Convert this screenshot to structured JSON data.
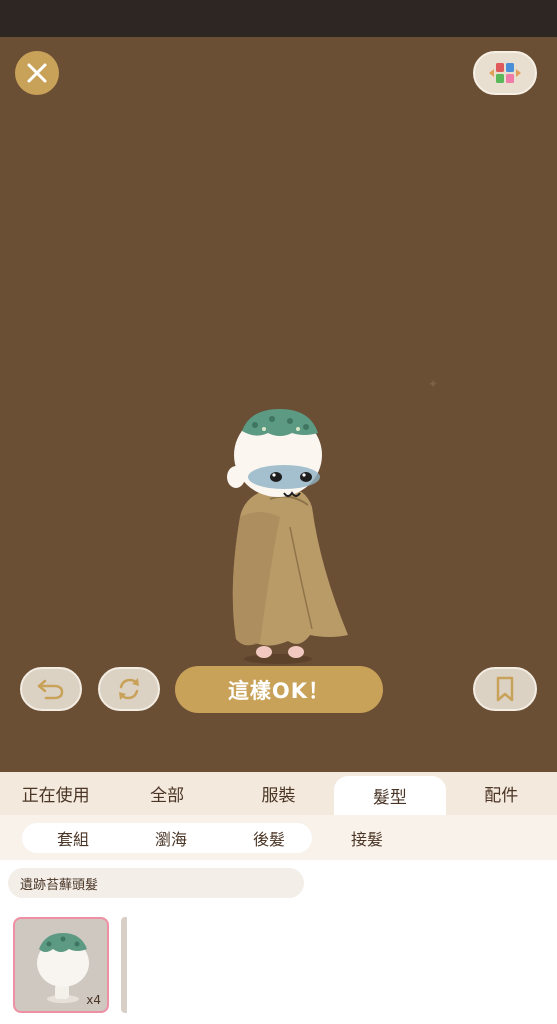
{
  "header": {
    "close_icon": "close-icon",
    "palette_icon": "color-palette-icon"
  },
  "toolbar": {
    "undo_icon": "undo-icon",
    "refresh_icon": "refresh-icon",
    "confirm_label": "這樣OK！",
    "bookmark_icon": "bookmark-icon"
  },
  "main_tabs": [
    {
      "label": "正在使用",
      "active": false
    },
    {
      "label": "全部",
      "active": false
    },
    {
      "label": "服裝",
      "active": false
    },
    {
      "label": "髮型",
      "active": true
    },
    {
      "label": "配件",
      "active": false
    }
  ],
  "sub_tabs": [
    {
      "label": "套組",
      "active": true
    },
    {
      "label": "瀏海",
      "active": false
    },
    {
      "label": "後髮",
      "active": false
    },
    {
      "label": "接髮",
      "active": false
    }
  ],
  "selected_item_name": "遺跡苔蘚頭髮",
  "items": [
    {
      "count": "x4",
      "selected": true
    }
  ],
  "colors": {
    "stage_bg": "#6b4f35",
    "accent_gold": "#c9a25a",
    "selected_border": "#ef8fa4"
  }
}
